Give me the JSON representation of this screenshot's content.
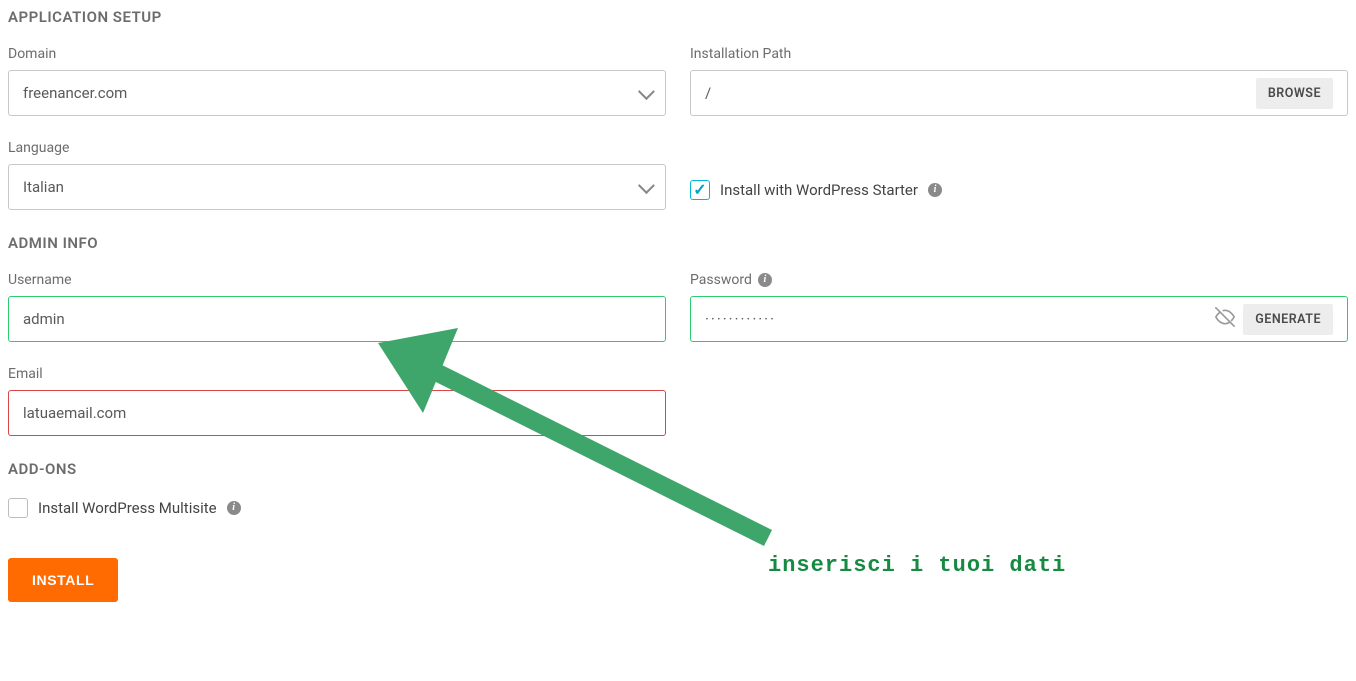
{
  "sections": {
    "app_setup": "APPLICATION SETUP",
    "admin_info": "ADMIN INFO",
    "addons": "ADD-ONS"
  },
  "labels": {
    "domain": "Domain",
    "installation_path": "Installation Path",
    "language": "Language",
    "wp_starter": "Install with WordPress Starter",
    "username": "Username",
    "password": "Password",
    "email": "Email",
    "multisite": "Install WordPress Multisite"
  },
  "values": {
    "domain": "freenancer.com",
    "installation_path": "/",
    "language": "Italian",
    "username": "admin",
    "password_mask": "············",
    "email": "latuaemail.com"
  },
  "buttons": {
    "browse": "BROWSE",
    "generate": "GENERATE",
    "install": "INSTALL"
  },
  "checkboxes": {
    "wp_starter_checked": true,
    "multisite_checked": false
  },
  "annotation": {
    "text": "inserisci i tuoi dati"
  }
}
